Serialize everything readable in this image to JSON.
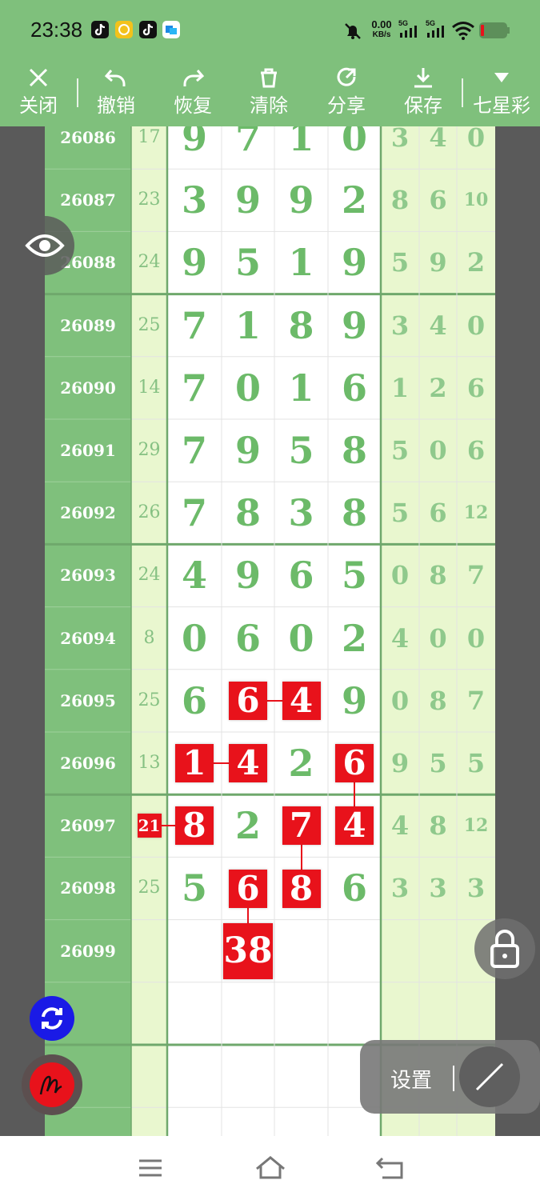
{
  "status_bar": {
    "time": "23:38",
    "net_speed_value": "0.00",
    "net_speed_unit": "KB/s",
    "signal1": "5G",
    "signal2": "5G",
    "icons": [
      "tiktok-icon",
      "yellow-app-icon",
      "tiktok-icon",
      "blue-app-icon",
      "mute-bell-icon",
      "signal-icon",
      "signal-icon",
      "wifi-icon",
      "battery-low-icon"
    ]
  },
  "toolbar": {
    "close": "关闭",
    "undo": "撤销",
    "redo": "恢复",
    "clear": "清除",
    "share": "分享",
    "save": "保存",
    "lottery": "七星彩",
    "accent": "#7fc07c"
  },
  "table": {
    "rows": [
      {
        "id": "26086",
        "sum": "17",
        "main": [
          "9",
          "7",
          "1",
          "0"
        ],
        "extra": [
          "3",
          "4",
          "0"
        ]
      },
      {
        "id": "26087",
        "sum": "23",
        "main": [
          "3",
          "9",
          "9",
          "2"
        ],
        "extra": [
          "8",
          "6",
          "10"
        ]
      },
      {
        "id": "26088",
        "sum": "24",
        "main": [
          "9",
          "5",
          "1",
          "9"
        ],
        "extra": [
          "5",
          "9",
          "2"
        ]
      },
      {
        "id": "26089",
        "sum": "25",
        "main": [
          "7",
          "1",
          "8",
          "9"
        ],
        "extra": [
          "3",
          "4",
          "0"
        ]
      },
      {
        "id": "26090",
        "sum": "14",
        "main": [
          "7",
          "0",
          "1",
          "6"
        ],
        "extra": [
          "1",
          "2",
          "6"
        ]
      },
      {
        "id": "26091",
        "sum": "29",
        "main": [
          "7",
          "9",
          "5",
          "8"
        ],
        "extra": [
          "5",
          "0",
          "6"
        ]
      },
      {
        "id": "26092",
        "sum": "26",
        "main": [
          "7",
          "8",
          "3",
          "8"
        ],
        "extra": [
          "5",
          "6",
          "12"
        ]
      },
      {
        "id": "26093",
        "sum": "24",
        "main": [
          "4",
          "9",
          "6",
          "5"
        ],
        "extra": [
          "0",
          "8",
          "7"
        ]
      },
      {
        "id": "26094",
        "sum": "8",
        "main": [
          "0",
          "6",
          "0",
          "2"
        ],
        "extra": [
          "4",
          "0",
          "0"
        ]
      },
      {
        "id": "26095",
        "sum": "25",
        "main": [
          "6",
          "6",
          "4",
          "9"
        ],
        "extra": [
          "0",
          "8",
          "7"
        ]
      },
      {
        "id": "26096",
        "sum": "13",
        "main": [
          "1",
          "4",
          "2",
          "6"
        ],
        "extra": [
          "9",
          "5",
          "5"
        ]
      },
      {
        "id": "26097",
        "sum": "21",
        "main": [
          "8",
          "2",
          "7",
          "4"
        ],
        "extra": [
          "4",
          "8",
          "12"
        ]
      },
      {
        "id": "26098",
        "sum": "25",
        "main": [
          "5",
          "6",
          "8",
          "6"
        ],
        "extra": [
          "3",
          "3",
          "3"
        ]
      },
      {
        "id": "26099",
        "sum": "",
        "main": [
          "",
          "38",
          "",
          ""
        ],
        "extra": [
          "",
          "",
          ""
        ]
      },
      {
        "id": "",
        "sum": "",
        "main": [
          "",
          "",
          "",
          ""
        ],
        "extra": [
          "",
          "",
          ""
        ]
      },
      {
        "id": "",
        "sum": "",
        "main": [
          "",
          "",
          "",
          ""
        ],
        "extra": [
          "",
          "",
          ""
        ]
      },
      {
        "id": "",
        "sum": "",
        "main": [
          "",
          "",
          "",
          ""
        ],
        "extra": [
          "",
          "",
          ""
        ]
      }
    ],
    "highlights": [
      {
        "row": 9,
        "col": "m1"
      },
      {
        "row": 9,
        "col": "m2"
      },
      {
        "row": 10,
        "col": "m0"
      },
      {
        "row": 10,
        "col": "m1"
      },
      {
        "row": 10,
        "col": "m3"
      },
      {
        "row": 11,
        "col": "sum"
      },
      {
        "row": 11,
        "col": "m0"
      },
      {
        "row": 11,
        "col": "m2"
      },
      {
        "row": 11,
        "col": "m3"
      },
      {
        "row": 12,
        "col": "m1"
      },
      {
        "row": 12,
        "col": "m2"
      },
      {
        "row": 13,
        "col": "m1"
      }
    ],
    "links": [
      [
        9,
        "m1",
        9,
        "m2"
      ],
      [
        10,
        "m0",
        10,
        "m1"
      ],
      [
        10,
        "m3",
        11,
        "m3"
      ],
      [
        11,
        "sum",
        11,
        "m0"
      ],
      [
        11,
        "m2",
        12,
        "m2"
      ],
      [
        12,
        "m1",
        13,
        "m1"
      ]
    ],
    "colors": {
      "header": "#7fc07c",
      "light": "#e9f7cf",
      "number": "#6cba69",
      "highlight": "#e8121b"
    }
  },
  "floating": {
    "settings_label": "设置",
    "eye": "eye-icon",
    "lock": "lock-icon",
    "refresh": "refresh-icon",
    "pen": "pen-icon"
  }
}
